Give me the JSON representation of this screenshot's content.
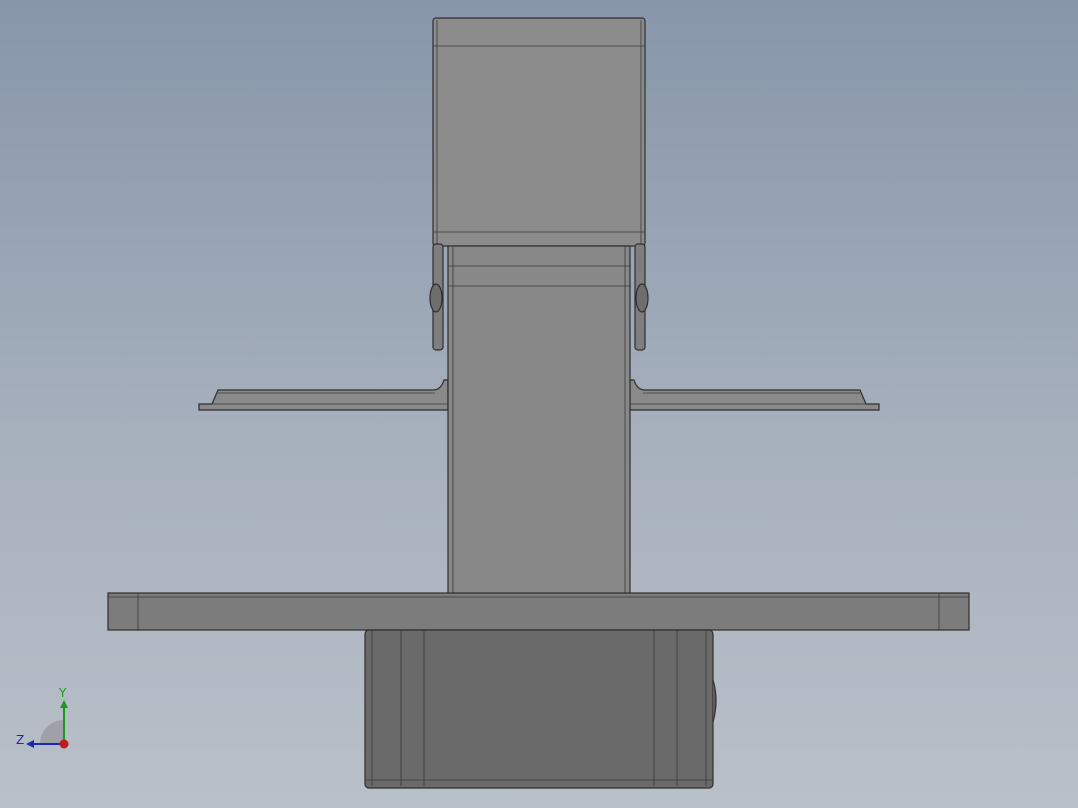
{
  "viewport": {
    "background_top": "#8796aa",
    "background_bottom": "#b9c0c9",
    "model_colors": {
      "light": "#8c8c8c",
      "mid": "#7a7a7a",
      "dark": "#6a6a6a",
      "edge": "#2e2e2e"
    }
  },
  "triad": {
    "y_label": "Y",
    "z_label": "Z",
    "y_color": "#1a9a1a",
    "z_color": "#1a2ab0",
    "x_color": "#c01a1a"
  }
}
